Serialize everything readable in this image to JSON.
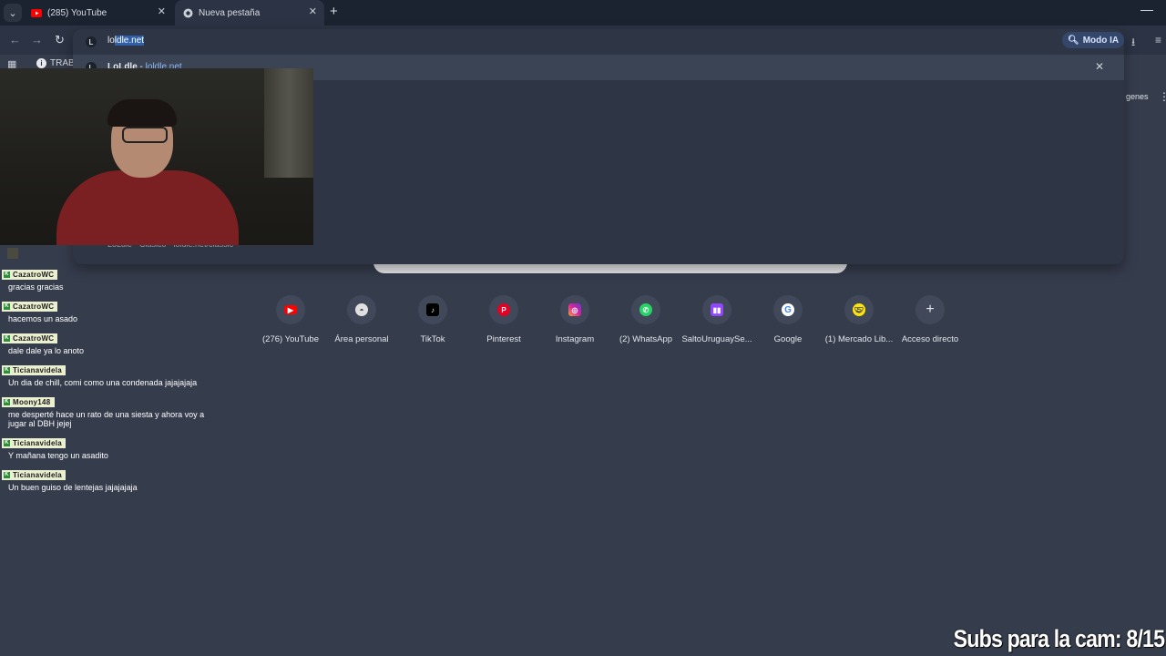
{
  "tabs": [
    {
      "label": "(285) YouTube",
      "icon": "youtube-icon"
    },
    {
      "label": "Nueva pestaña",
      "icon": "chrome-icon"
    }
  ],
  "omnibox": {
    "typed": "lo",
    "autocomplete": "ldle.net",
    "site_badge": "L",
    "suggestion": {
      "title": "LoLdle",
      "sep": " - ",
      "url": "loldle.net"
    },
    "suggestion2": "LoLdle - Clásico - loldle.net/classic"
  },
  "toolbar": {
    "mode_ai": "Modo IA"
  },
  "bookmarks": {
    "info_label": "TRABA"
  },
  "partial": {
    "imagenes": "genes"
  },
  "chat": [
    {
      "user": "CazatroWC",
      "text": "gracias gracias"
    },
    {
      "user": "CazatroWC",
      "text": "hacemos un asado"
    },
    {
      "user": "CazatroWC",
      "text": "dale dale ya lo anoto"
    },
    {
      "user": "Ticianavidela",
      "text": "Un dia de chill, comi como una condenada jajajajaja"
    },
    {
      "user": "Moony148",
      "text": "me desperté hace un rato de una siesta y ahora voy a jugar al DBH jejej"
    },
    {
      "user": "Ticianavidela",
      "text": "Y mañana tengo un asadito"
    },
    {
      "user": "Ticianavidela",
      "text": "Un buen guiso de lentejas jajajajaja"
    }
  ],
  "shortcuts": [
    {
      "label": "(276) YouTube",
      "icon": "youtube-icon",
      "color": "#ff0000"
    },
    {
      "label": "Área personal",
      "icon": "moodle-icon",
      "color": "#e0e0e0"
    },
    {
      "label": "TikTok",
      "icon": "tiktok-icon",
      "color": "#000000"
    },
    {
      "label": "Pinterest",
      "icon": "pinterest-icon",
      "color": "#e60023"
    },
    {
      "label": "Instagram",
      "icon": "instagram-icon",
      "color": "#d6249f"
    },
    {
      "label": "(2) WhatsApp",
      "icon": "whatsapp-icon",
      "color": "#25d366"
    },
    {
      "label": "SaltoUruguaySe...",
      "icon": "twitch-icon",
      "color": "#9146ff"
    },
    {
      "label": "Google",
      "icon": "google-icon",
      "color": "#ffffff"
    },
    {
      "label": "(1) Mercado Lib...",
      "icon": "mercadolibre-icon",
      "color": "#ffe600"
    },
    {
      "label": "Acceso directo",
      "icon": "plus-icon",
      "color": "#404859"
    }
  ],
  "overlay": {
    "subs": "Subs para la cam: 8/15"
  }
}
